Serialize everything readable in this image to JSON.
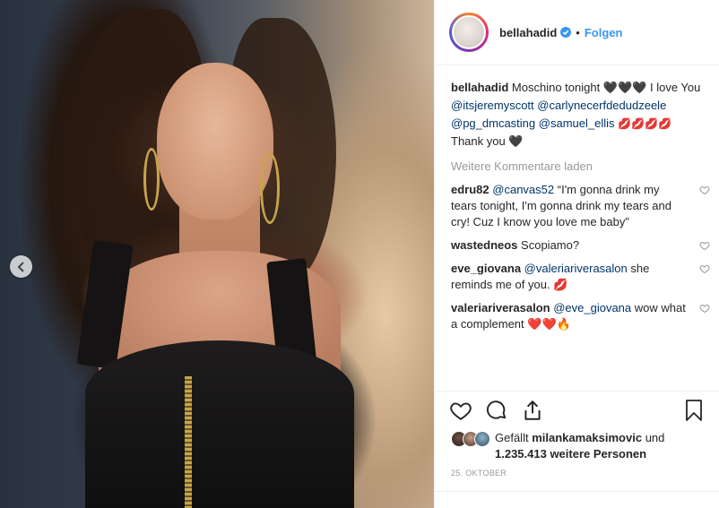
{
  "post": {
    "username": "bellahadid",
    "separator": "•",
    "follow_label": "Folgen",
    "caption": {
      "user": "bellahadid",
      "part1": "Moschino tonight 🖤🖤🖤 I love You",
      "mention1": "@itsjeremyscott",
      "mention2": "@carlynecerfdedudzeele",
      "mention3": "@pg_dmcasting",
      "mention4": "@samuel_ellis",
      "lips": "💋💋💋💋",
      "part2": "Thank you 🖤"
    },
    "load_more": "Weitere Kommentare laden",
    "comments": [
      {
        "user": "edru82",
        "mention": "@canvas52",
        "text": "“I'm gonna drink my tears tonight, I'm gonna drink my tears and cry! Cuz I know you love me baby”"
      },
      {
        "user": "wastedneos",
        "mention": "",
        "text": "Scopiamo?"
      },
      {
        "user": "eve_giovana",
        "mention": "@valeriariverasalon",
        "text": "she reminds me of you. 💋"
      },
      {
        "user": "valeriariverasalon",
        "mention": "@eve_giovana",
        "text": "wow what a complement ❤️❤️🔥"
      }
    ],
    "likes": {
      "prefix": "Gefällt",
      "user": "milankamaksimovic",
      "connector": "und",
      "count": "1.235.413 weitere Personen"
    },
    "date": "25. OKTOBER"
  },
  "colors": {
    "accent": "#3897f0",
    "mention": "#003569",
    "muted": "#999999",
    "border": "#efefef"
  },
  "icons": [
    "chevron-left-icon",
    "verified-icon",
    "heart-icon",
    "comment-icon",
    "share-icon",
    "bookmark-icon"
  ]
}
